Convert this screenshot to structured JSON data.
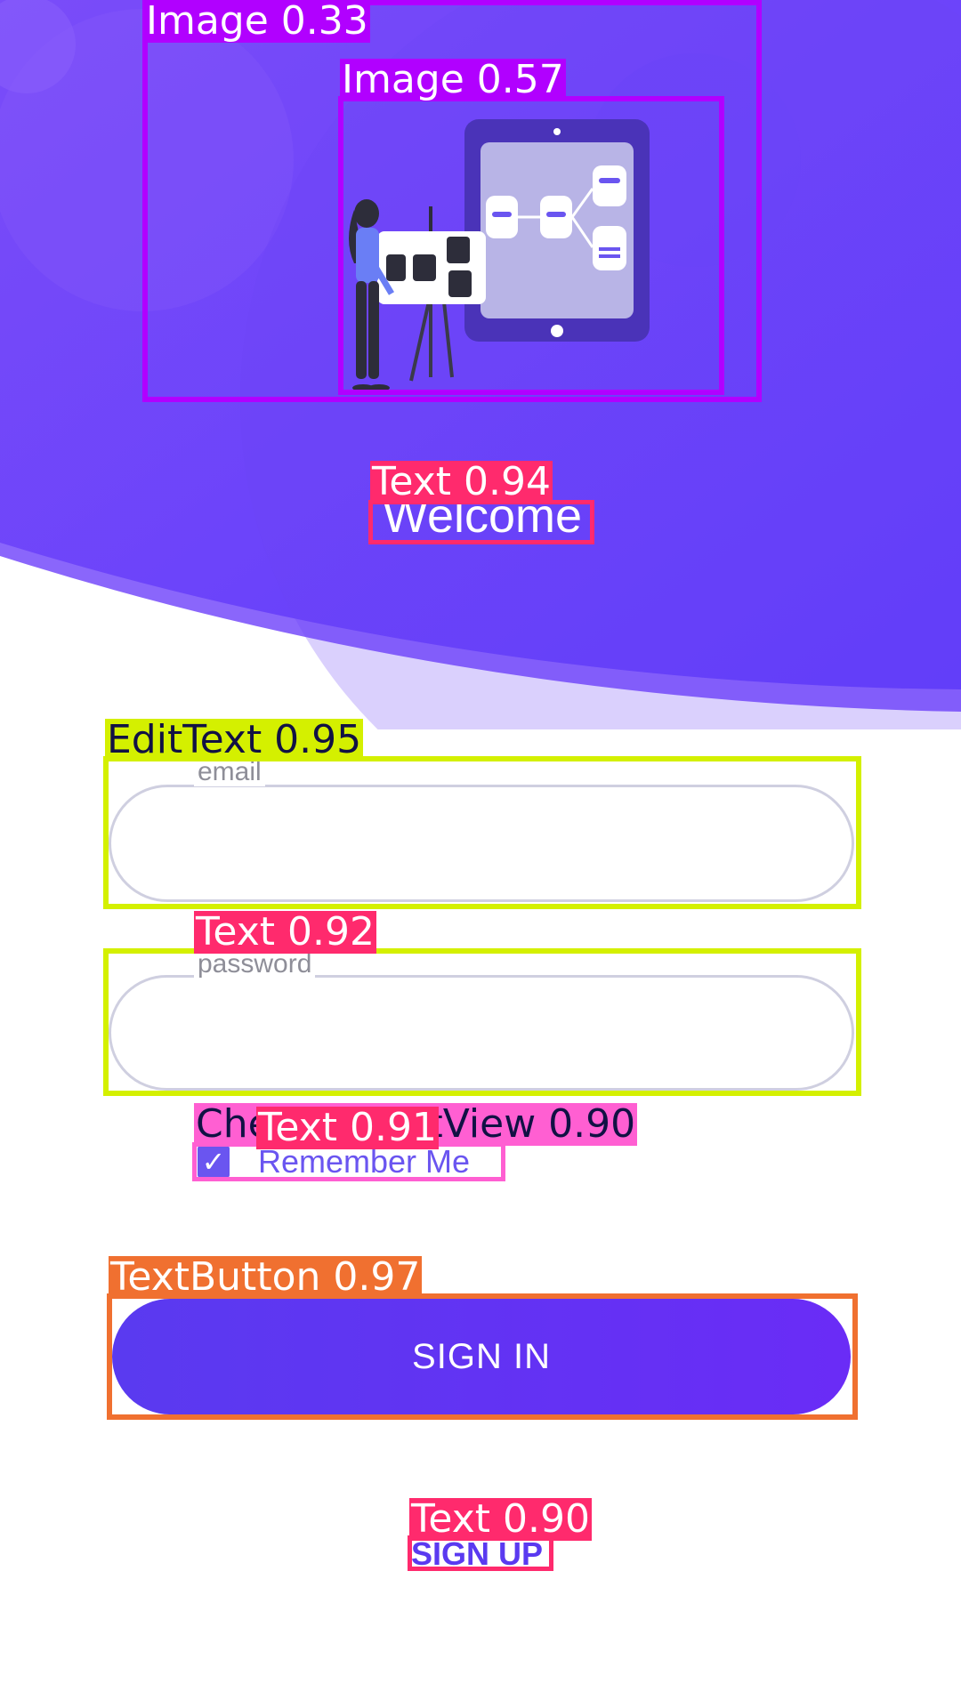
{
  "colors": {
    "hero_top": "#7a4cf9",
    "hero_bottom": "#5f3cfa",
    "accent": "#6a55f0",
    "button_start": "#5a3af0",
    "button_end": "#6a2cf6",
    "field_border": "#cfcfe0"
  },
  "hero": {
    "welcome_text": "Welcome",
    "illustration_icon": "presentation-illustration-icon"
  },
  "form": {
    "email": {
      "label": "email",
      "value": ""
    },
    "password": {
      "label": "password",
      "value": ""
    },
    "remember_me": {
      "label": "Remember Me",
      "checked": true,
      "check_glyph": "✓"
    },
    "sign_in_label": "SIGN IN",
    "sign_up_label": "SIGN UP"
  },
  "detections": [
    {
      "label": "Image 0.33",
      "color": "#b100ff"
    },
    {
      "label": "Image 0.57",
      "color": "#b100ff"
    },
    {
      "label": "Text 0.94",
      "color": "#ff2a6d"
    },
    {
      "label": "EditText 0.95",
      "color": "#d4f000"
    },
    {
      "label": "Text 0.92",
      "color": "#ff2a6d"
    },
    {
      "label": "CheckedTextView 0.90",
      "color": "#ff5fd2"
    },
    {
      "label": "Text 0.91",
      "color": "#ff2a6d"
    },
    {
      "label": "TextButton 0.97",
      "color": "#f07030"
    },
    {
      "label": "Text 0.90",
      "color": "#ff2a6d"
    }
  ]
}
